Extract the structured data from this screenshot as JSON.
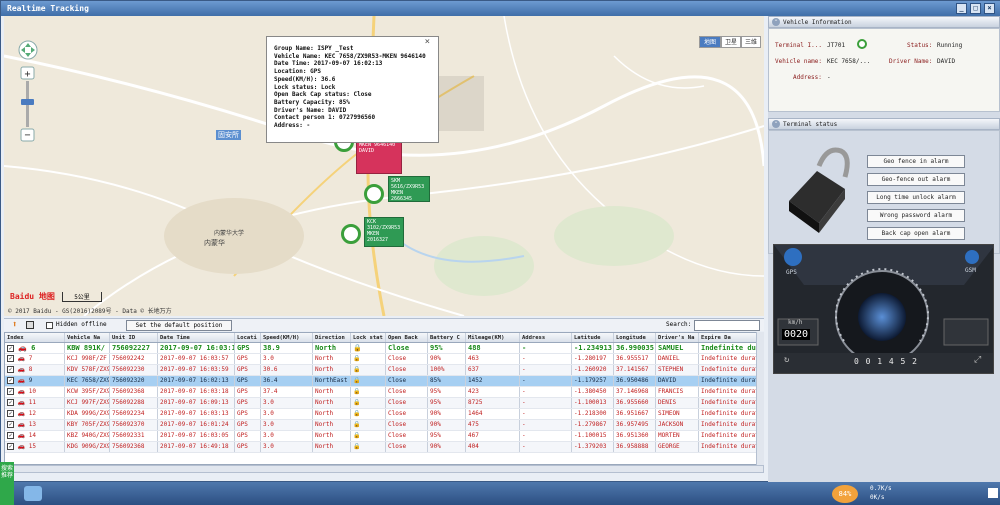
{
  "window": {
    "title": "Realtime Tracking"
  },
  "map": {
    "map_types": [
      "地图",
      "卫星",
      "三维"
    ],
    "active_type": 0,
    "copyright": "© 2017 Baidu - GS(2016)2089号 - Data © 长地万方",
    "scale": "5公里",
    "logo": "Baidu 地图",
    "labels": [
      "内蒙华",
      "固安所",
      "内蒙华大学"
    ],
    "popup": [
      "Group Name: ISPY _Test",
      "Vehicle Name: KEC 7658/ZX9R53-MKEN 9646140",
      "Date Time: 2017-09-07 16:02:13",
      "Location: GPS",
      "Speed(KM/H): 36.6",
      "Lock status: Lock",
      "Open Back Cap status: Close",
      "Battery Capacity: 85%",
      "Driver's Name: DAVID",
      "Contact person 1: 0727996560",
      "Address: -"
    ],
    "vehicle_tags": [
      {
        "text": "KEC 7658/ZX9R53 MKEN 9646140 DAVID",
        "color": "#d6335c"
      },
      {
        "text": "SKM 5616/ZX9R53 MKEN 2666345",
        "color": "#2f9a54"
      },
      {
        "text": "KCK 3102/ZX9R53 MKEN 2016327",
        "color": "#2f9a54"
      }
    ]
  },
  "vehicle_info": {
    "title": "Vehicle Information",
    "terminal_label": "Terminal I...",
    "terminal_value": "JT701",
    "status_label": "Status:",
    "status_value": "Running",
    "vehicle_label": "Vehicle name:",
    "vehicle_value": "KEC 7658/...",
    "driver_label": "Driver Name:",
    "driver_value": "DAVID",
    "address_label": "Address:",
    "address_value": "-"
  },
  "terminal_status": {
    "title": "Terminal status",
    "alarms": [
      "Geo fence in alarm",
      "Geo-fence out alarm",
      "Long time unlock alarm",
      "Wrong password alarm",
      "Back cap open alarm"
    ]
  },
  "dashboard": {
    "gps": "GPS",
    "gsm": "GSM",
    "speed_unit": "km/h",
    "speed_digits": "0020",
    "odometer": "0 0 1 4 5 2",
    "gauge_ticks": [
      "20",
      "40",
      "60",
      "80",
      "100",
      "120",
      "140",
      "160"
    ]
  },
  "toolbar": {
    "hidden_offline": "Hidden offline",
    "default_position": "Set the default position",
    "search_label": "Search:",
    "search_value": ""
  },
  "table": {
    "columns": [
      "Index",
      "Vehicle Na",
      "Unit ID",
      "Date Time",
      "Locati",
      "Speed(KM/H)",
      "Direction",
      "Lock stat",
      "Open Back",
      "Battery C",
      "Mileage(KM)",
      "Address",
      "Latitude",
      "Longitude",
      "Driver's Na",
      "Expire Da"
    ],
    "rows": [
      {
        "index": "6",
        "name": "KBW 891K/",
        "unit": "756092227",
        "time": "2017-09-07 16:03:1",
        "loc": "GPS",
        "speed": "38.9",
        "dir": "North",
        "lock": "",
        "back": "Close",
        "bat": "95%",
        "mile": "488",
        "addr": "-",
        "lat": "-1.234913",
        "lng": "36.990035",
        "driver": "SAMUEL",
        "expire": "Indefinite dura",
        "cls": "first"
      },
      {
        "index": "7",
        "name": "KCJ 998F/ZF",
        "unit": "756092242",
        "time": "2017-09-07 16:03:57",
        "loc": "GPS",
        "speed": "3.0",
        "dir": "North",
        "lock": "",
        "back": "Close",
        "bat": "90%",
        "mile": "463",
        "addr": "-",
        "lat": "-1.280197",
        "lng": "36.955517",
        "driver": "DANIEL",
        "expire": "Indefinite duration",
        "cls": ""
      },
      {
        "index": "8",
        "name": "KDV 578F/ZX9",
        "unit": "756092230",
        "time": "2017-09-07 16:03:59",
        "loc": "GPS",
        "speed": "30.6",
        "dir": "North",
        "lock": "",
        "back": "Close",
        "bat": "100%",
        "mile": "637",
        "addr": "-",
        "lat": "-1.260920",
        "lng": "37.141567",
        "driver": "STEPHEN",
        "expire": "Indefinite duration",
        "cls": "alt"
      },
      {
        "index": "9",
        "name": "KEC 7658/ZX9",
        "unit": "756092320",
        "time": "2017-09-07 16:02:13",
        "loc": "GPS",
        "speed": "36.4",
        "dir": "NorthEast",
        "lock": "",
        "back": "Close",
        "bat": "85%",
        "mile": "1452",
        "addr": "-",
        "lat": "-1.179257",
        "lng": "36.950486",
        "driver": "DAVID",
        "expire": "Indefinite duration",
        "cls": "sel"
      },
      {
        "index": "10",
        "name": "KCW 395F/ZX9",
        "unit": "756092368",
        "time": "2017-09-07 16:03:18",
        "loc": "GPS",
        "speed": "37.4",
        "dir": "North",
        "lock": "",
        "back": "Close",
        "bat": "95%",
        "mile": "423",
        "addr": "-",
        "lat": "-1.380450",
        "lng": "37.146968",
        "driver": "FRANCIS",
        "expire": "Indefinite duration",
        "cls": ""
      },
      {
        "index": "11",
        "name": "KCJ 997F/ZX9",
        "unit": "756092288",
        "time": "2017-09-07 16:09:13",
        "loc": "GPS",
        "speed": "3.0",
        "dir": "North",
        "lock": "",
        "back": "Close",
        "bat": "95%",
        "mile": "8725",
        "addr": "-",
        "lat": "-1.100013",
        "lng": "36.955660",
        "driver": "DENIS",
        "expire": "Indefinite duration",
        "cls": "alt"
      },
      {
        "index": "12",
        "name": "KDA 999G/ZX9",
        "unit": "756092234",
        "time": "2017-09-07 16:03:13",
        "loc": "GPS",
        "speed": "3.0",
        "dir": "North",
        "lock": "",
        "back": "Close",
        "bat": "90%",
        "mile": "1464",
        "addr": "-",
        "lat": "-1.218300",
        "lng": "36.951667",
        "driver": "SIMEON",
        "expire": "Indefinite duration",
        "cls": ""
      },
      {
        "index": "13",
        "name": "KBY 705F/ZX9",
        "unit": "756092370",
        "time": "2017-09-07 16:01:24",
        "loc": "GPS",
        "speed": "3.0",
        "dir": "North",
        "lock": "",
        "back": "Close",
        "bat": "90%",
        "mile": "475",
        "addr": "-",
        "lat": "-1.279867",
        "lng": "36.957495",
        "driver": "JACKSON",
        "expire": "Indefinite duration",
        "cls": "alt"
      },
      {
        "index": "14",
        "name": "KBZ 940G/ZX9",
        "unit": "756092331",
        "time": "2017-09-07 16:03:05",
        "loc": "GPS",
        "speed": "3.0",
        "dir": "North",
        "lock": "",
        "back": "Close",
        "bat": "95%",
        "mile": "467",
        "addr": "-",
        "lat": "-1.100015",
        "lng": "36.951360",
        "driver": "MORTEN",
        "expire": "Indefinite duration",
        "cls": ""
      },
      {
        "index": "15",
        "name": "KDG 909G/ZX9",
        "unit": "756092368",
        "time": "2017-09-07 16:49:18",
        "loc": "GPS",
        "speed": "3.0",
        "dir": "North",
        "lock": "",
        "back": "Close",
        "bat": "90%",
        "mile": "404",
        "addr": "-",
        "lat": "-1.379203",
        "lng": "36.958888",
        "driver": "GEORGE",
        "expire": "Indefinite duration",
        "cls": "alt"
      }
    ]
  },
  "taskbar": {
    "start_label": "搜索推荐",
    "battery": "84%",
    "net_up": "0.7K/s",
    "net_down": "0K/s"
  }
}
